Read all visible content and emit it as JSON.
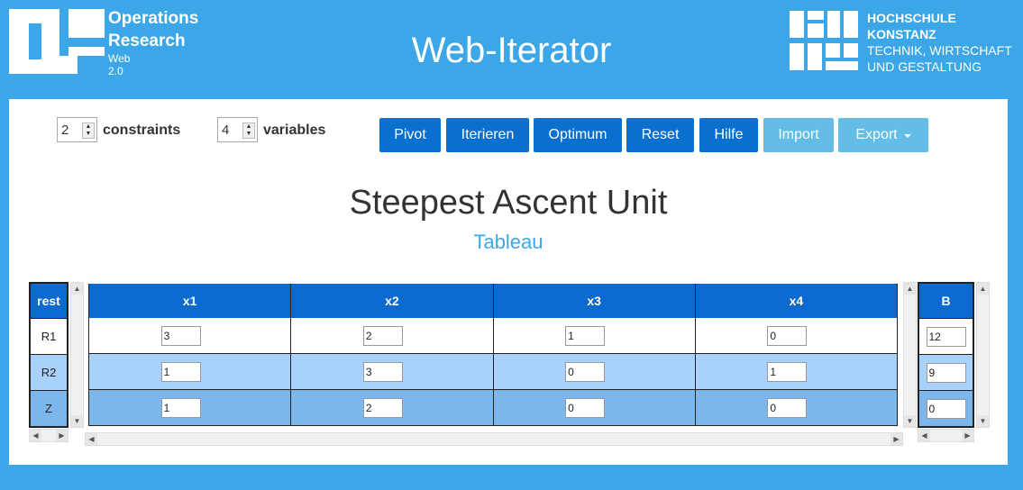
{
  "header": {
    "logo_line1": "Operations",
    "logo_line2": "Research",
    "logo_line3": "Web",
    "logo_line4": "2.0",
    "app_title": "Web-Iterator",
    "uni_line1": "HOCHSCHULE",
    "uni_line2": "KONSTANZ",
    "uni_line3": "TECHNIK, WIRTSCHAFT",
    "uni_line4": "UND GESTALTUNG"
  },
  "controls": {
    "constraints_value": "2",
    "constraints_label": "constraints",
    "variables_value": "4",
    "variables_label": "variables"
  },
  "toolbar": {
    "pivot": "Pivot",
    "iterieren": "Iterieren",
    "optimum": "Optimum",
    "reset": "Reset",
    "hilfe": "Hilfe",
    "import": "Import",
    "export": "Export"
  },
  "content": {
    "title": "Steepest Ascent Unit",
    "subtitle": "Tableau"
  },
  "tableau": {
    "rest_header": "rest",
    "row_labels": [
      "R1",
      "R2",
      "Z"
    ],
    "columns": [
      "x1",
      "x2",
      "x3",
      "x4"
    ],
    "b_header": "B",
    "rows": [
      [
        "3",
        "2",
        "1",
        "0"
      ],
      [
        "1",
        "3",
        "0",
        "1"
      ],
      [
        "1",
        "2",
        "0",
        "0"
      ]
    ],
    "b_values": [
      "12",
      "9",
      "0"
    ]
  },
  "colors": {
    "page_bg": "#3ba7e8",
    "header_cell": "#0a6ad0",
    "button": "#0a70d0",
    "button_disabled": "#63bde6",
    "row_r1": "#ffffff",
    "row_r2": "#a8d2fb",
    "row_z": "#7cb6ea"
  }
}
